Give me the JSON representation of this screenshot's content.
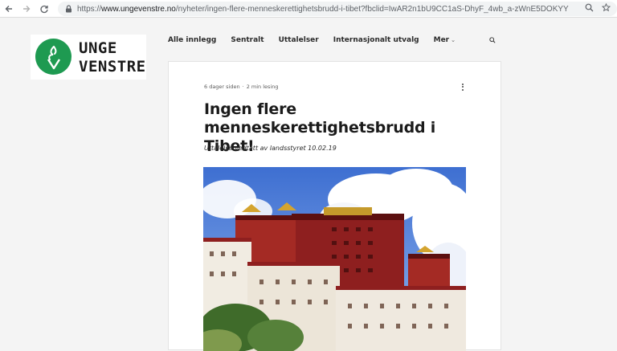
{
  "browser": {
    "url_scheme": "https://",
    "url_host": "www.ungevenstre.no",
    "url_path": "/nyheter/ingen-flere-menneskerettighetsbrudd-i-tibet?fbclid=IwAR2n1bU9CC1aS-DhyF_4wb_a-zWnE5DOKYYF5ktOQ603..."
  },
  "site": {
    "logo_line1": "UNGE",
    "logo_line2": "VENSTRE",
    "brand_color": "#1e9a51"
  },
  "menu": {
    "items": [
      "Alle innlegg",
      "Sentralt",
      "Uttalelser",
      "Internasjonalt utvalg"
    ],
    "more_label": "Mer"
  },
  "post": {
    "date": "6 dager siden",
    "separator": "·",
    "read_time": "2 min lesing",
    "title": "Ingen flere menneskerettighetsbrudd i Tibet!",
    "subtitle": "Uttalelse vedtatt av landsstyret 10.02.19"
  }
}
